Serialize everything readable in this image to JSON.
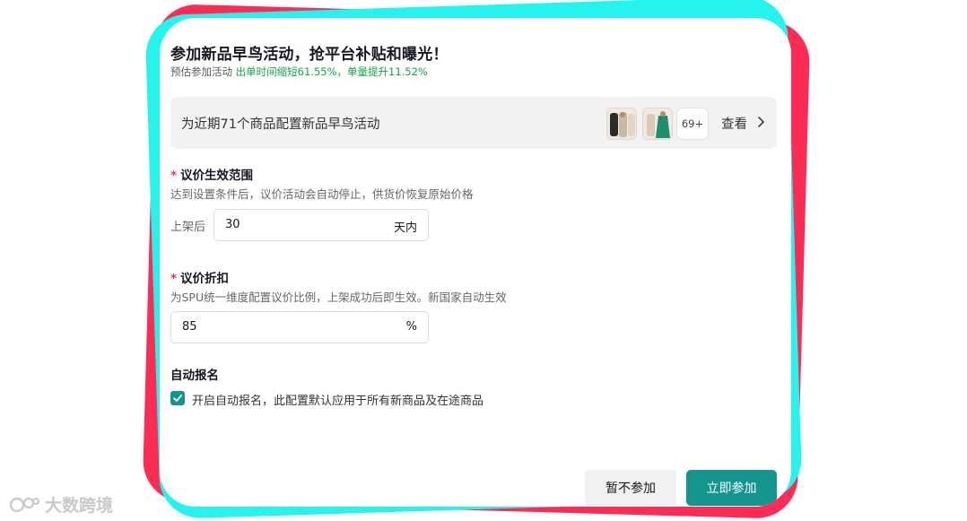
{
  "header": {
    "title": "参加新品早鸟活动，抢平台补贴和曝光！",
    "subtitle_prefix": "预估参加活动 ",
    "subtitle_highlight": "出单时间缩短61.55%，单量提升11.52%"
  },
  "banner": {
    "text": "为近期71个商品配置新品早鸟活动",
    "more_count": "69+",
    "view_label": "查看"
  },
  "price_range": {
    "required_mark": "*",
    "label": "议价生效范围",
    "description": "达到设置条件后，议价活动会自动停止，供货价恢复原始价格",
    "prefix": "上架后",
    "value": "30",
    "unit": "天内"
  },
  "discount": {
    "required_mark": "*",
    "label": "议价折扣",
    "description": "为SPU统一维度配置议价比例，上架成功后即生效。新国家自动生效",
    "value": "85",
    "unit": "%"
  },
  "auto_enroll": {
    "label": "自动报名",
    "checkbox_checked": true,
    "checkbox_label": "开启自动报名，此配置默认应用于所有新商品及在途商品"
  },
  "footer": {
    "skip_label": "暂不参加",
    "join_label": "立即参加"
  },
  "watermark": {
    "text": "大数跨境"
  },
  "colors": {
    "accent": "#14958f",
    "highlight": "#16a34a",
    "frame_red": "#fe2c55",
    "frame_cyan": "#25f4ee"
  }
}
